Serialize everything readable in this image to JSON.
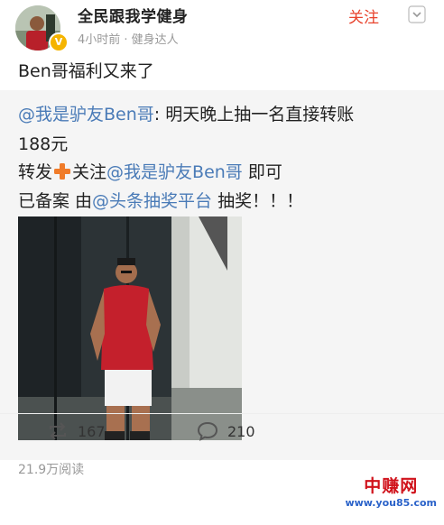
{
  "author": {
    "name": "全民跟我学健身",
    "meta": "4小时前 · 健身达人",
    "badge": "V"
  },
  "follow_label": "关注",
  "post": {
    "text": "Ben哥福利又来了"
  },
  "quote": {
    "mention1": "@我是驴友Ben哥",
    "line1_rest": ": 明天晚上抽一名直接转账",
    "line2": "188元",
    "line3_pre": "转发",
    "line3_mid": "关注",
    "mention2": "@我是驴友Ben哥",
    "line3_post": " 即可",
    "line4_pre": "已备案 由",
    "mention3": "@头条抽奖平台",
    "line4_post": " 抽奖！！！"
  },
  "stats": {
    "views": "21.9万阅读",
    "reposts": "167",
    "comments": "210"
  },
  "watermark": {
    "cn": "中赚网",
    "url": "www.you85.com"
  },
  "colors": {
    "accent": "#e8432d",
    "link": "#4a7bb7",
    "quote_bg": "#f5f5f5",
    "plus": "#f07c2a"
  },
  "icons": {
    "repost": "repost-icon",
    "comment": "comment-icon",
    "more": "chevron-down-icon",
    "plus": "plus-emoji-icon"
  }
}
